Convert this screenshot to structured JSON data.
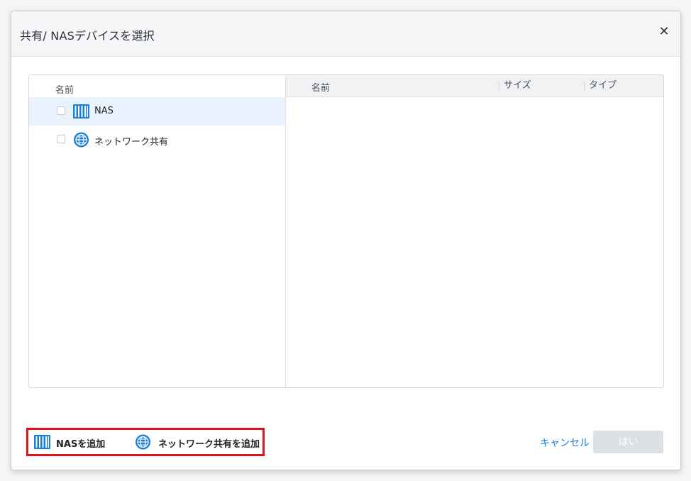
{
  "dialog": {
    "title": "共有/ NASデバイスを選択",
    "close_icon": "close-icon"
  },
  "left_pane": {
    "header": "名前",
    "items": [
      {
        "label": "NAS",
        "icon": "nas-icon",
        "selected": true,
        "checked": false
      },
      {
        "label": "ネットワーク共有",
        "icon": "globe-icon",
        "selected": false,
        "checked": false
      }
    ]
  },
  "right_pane": {
    "columns": [
      "名前",
      "サイズ",
      "タイプ"
    ]
  },
  "footer": {
    "add_nas": "NASを追加",
    "add_network_share": "ネットワーク共有を追加",
    "cancel": "キャンセル",
    "ok": "はい"
  },
  "colors": {
    "accent": "#1a7fd6",
    "highlight_border": "#e0101c",
    "selected_row": "#e9f3fd",
    "disabled_button": "#dcdfe3"
  }
}
